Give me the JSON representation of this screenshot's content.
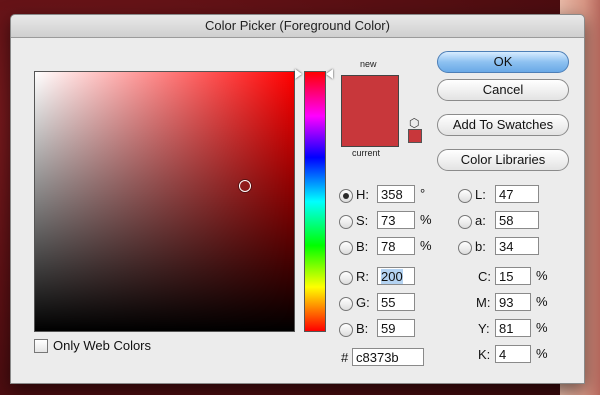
{
  "window": {
    "title": "Color Picker (Foreground Color)"
  },
  "swatch": {
    "new_label": "new",
    "current_label": "current",
    "new_color": "#c8373b",
    "current_color": "#c8373b"
  },
  "buttons": {
    "ok": "OK",
    "cancel": "Cancel",
    "add_to_swatches": "Add To Swatches",
    "color_libraries": "Color Libraries"
  },
  "hsb": {
    "h": {
      "label": "H:",
      "value": "358",
      "unit": "°"
    },
    "s": {
      "label": "S:",
      "value": "73",
      "unit": "%"
    },
    "b": {
      "label": "B:",
      "value": "78",
      "unit": "%"
    }
  },
  "rgb": {
    "r": {
      "label": "R:",
      "value": "200"
    },
    "g": {
      "label": "G:",
      "value": "55"
    },
    "b": {
      "label": "B:",
      "value": "59"
    }
  },
  "lab": {
    "l": {
      "label": "L:",
      "value": "47"
    },
    "a": {
      "label": "a:",
      "value": "58"
    },
    "b": {
      "label": "b:",
      "value": "34"
    }
  },
  "cmyk": {
    "c": {
      "label": "C:",
      "value": "15",
      "unit": "%"
    },
    "m": {
      "label": "M:",
      "value": "93",
      "unit": "%"
    },
    "y": {
      "label": "Y:",
      "value": "81",
      "unit": "%"
    },
    "k": {
      "label": "K:",
      "value": "4",
      "unit": "%"
    }
  },
  "hex": {
    "label": "#",
    "value": "c8373b"
  },
  "options": {
    "only_web_colors": "Only Web Colors"
  },
  "colors": {
    "accent": "#6aa9e6",
    "hue_color": "#ff0000"
  },
  "icons": {
    "gamut_warning": "cube-icon"
  }
}
